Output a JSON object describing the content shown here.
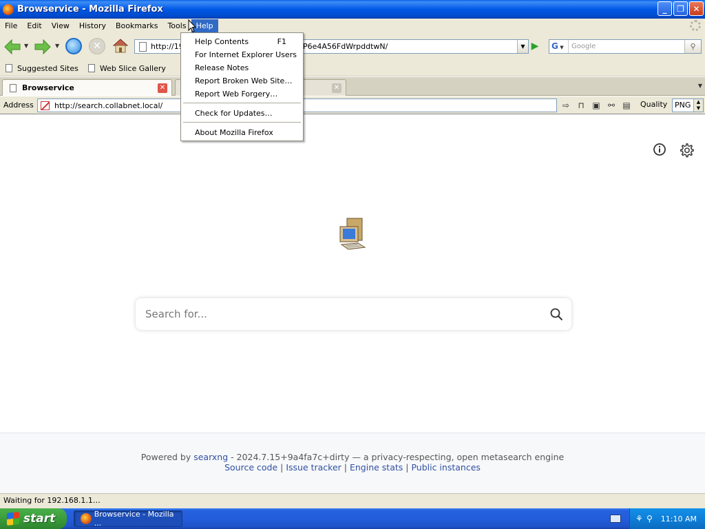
{
  "window": {
    "title": "Browservice - Mozilla Firefox"
  },
  "menubar": {
    "items": [
      "File",
      "Edit",
      "View",
      "History",
      "Bookmarks",
      "Tools",
      "Help"
    ]
  },
  "nav": {
    "url_prefix": "http://19",
    "url_suffix": "P6e4A56FdWrpddtwN/",
    "search_engine": "G",
    "search_placeholder": "Google"
  },
  "bookmarks": [
    "Suggested Sites",
    "Web Slice Gallery"
  ],
  "tabs": [
    {
      "label": "Browservice",
      "active": true
    },
    {
      "label": "",
      "active": false
    }
  ],
  "address": {
    "label": "Address",
    "value": "http://search.collabnet.local/",
    "quality_label": "Quality",
    "format": "PNG"
  },
  "help_menu": {
    "items": [
      {
        "label": "Help Contents",
        "shortcut": "F1"
      },
      {
        "label": "For Internet Explorer Users",
        "shortcut": ""
      },
      {
        "label": "Release Notes",
        "shortcut": ""
      },
      {
        "label": "Report Broken Web Site…",
        "shortcut": ""
      },
      {
        "label": "Report Web Forgery…",
        "shortcut": ""
      },
      {
        "label": "Check for Updates…",
        "shortcut": ""
      },
      {
        "label": "About Mozilla Firefox",
        "shortcut": ""
      }
    ]
  },
  "page": {
    "search_placeholder": "Search for...",
    "footer": {
      "powered_by": "Powered by",
      "searxng": "searxng",
      "version_text": " - 2024.7.15+9a4fa7c+dirty — a privacy-respecting, open metasearch engine",
      "links": [
        "Source code",
        "Issue tracker",
        "Engine stats",
        "Public instances"
      ]
    }
  },
  "status": {
    "text": "Waiting for 192.168.1.1…"
  },
  "taskbar": {
    "start": "start",
    "task": "Browservice - Mozilla ...",
    "clock": "11:10 AM"
  }
}
